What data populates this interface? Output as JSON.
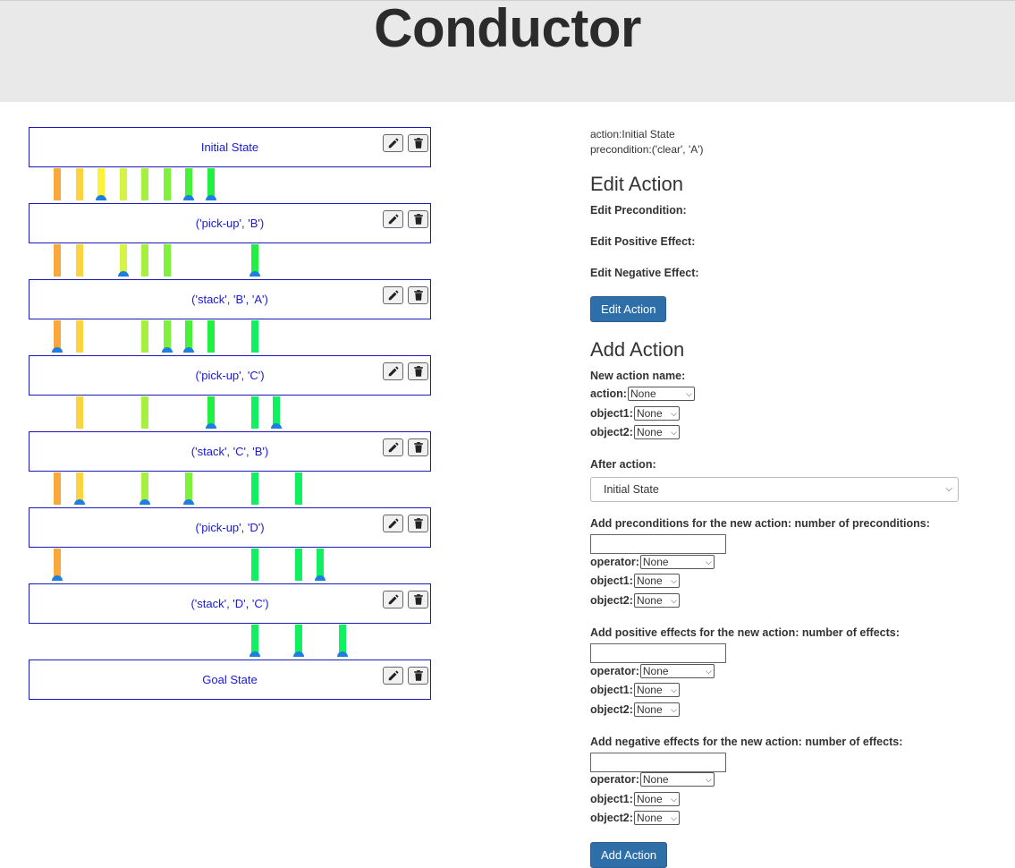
{
  "app": {
    "title": "Conductor"
  },
  "plan": {
    "actions": [
      {
        "label": "Initial State"
      },
      {
        "label": "('pick-up', 'B')"
      },
      {
        "label": "('stack', 'B', 'A')"
      },
      {
        "label": "('pick-up', 'C')"
      },
      {
        "label": "('stack', 'C', 'B')"
      },
      {
        "label": "('pick-up', 'D')"
      },
      {
        "label": "('stack', 'D', 'C')"
      },
      {
        "label": "Goal State"
      }
    ],
    "connector_colors": [
      "#f7a93a",
      "#fdd43f",
      "#fbf337",
      "#d4f545",
      "#a8f03f",
      "#7ef23a",
      "#49f03a",
      "#22f040",
      "#15f050",
      "#10f060"
    ],
    "dot_color": "#1e7fe0",
    "link_columns": [
      {
        "gap": 0,
        "cols": [
          [
            0,
            0,
            0
          ],
          [
            1,
            1,
            0
          ],
          [
            2,
            2,
            1
          ],
          [
            3,
            3,
            0
          ],
          [
            4,
            4,
            0
          ],
          [
            5,
            5,
            0
          ],
          [
            6,
            6,
            1
          ],
          [
            7,
            7,
            1
          ]
        ]
      },
      {
        "gap": 1,
        "cols": [
          [
            0,
            0,
            0
          ],
          [
            1,
            1,
            0
          ],
          [
            3,
            3,
            1
          ],
          [
            4,
            4,
            0
          ],
          [
            5,
            5,
            0
          ],
          [
            9,
            7,
            1
          ]
        ]
      },
      {
        "gap": 2,
        "cols": [
          [
            0,
            0,
            1
          ],
          [
            1,
            1,
            0
          ],
          [
            4,
            4,
            0
          ],
          [
            5,
            5,
            1
          ],
          [
            6,
            6,
            1
          ],
          [
            7,
            7,
            0
          ],
          [
            9,
            9,
            0
          ]
        ]
      },
      {
        "gap": 3,
        "cols": [
          [
            1,
            1,
            0
          ],
          [
            4,
            4,
            0
          ],
          [
            7,
            7,
            1
          ],
          [
            9,
            9,
            0
          ],
          [
            10,
            9,
            1
          ]
        ]
      },
      {
        "gap": 4,
        "cols": [
          [
            0,
            0,
            0
          ],
          [
            1,
            1,
            1
          ],
          [
            4,
            4,
            1
          ],
          [
            6,
            5,
            1
          ],
          [
            9,
            9,
            0
          ],
          [
            11,
            9,
            0
          ]
        ]
      },
      {
        "gap": 5,
        "cols": [
          [
            0,
            0,
            1
          ],
          [
            9,
            9,
            0
          ],
          [
            11,
            9,
            0
          ],
          [
            12,
            9,
            1
          ]
        ]
      },
      {
        "gap": 6,
        "cols": [
          [
            9,
            9,
            1
          ],
          [
            11,
            9,
            1
          ],
          [
            13,
            9,
            1
          ]
        ]
      }
    ]
  },
  "panel": {
    "info": {
      "action_line": "action:Initial State",
      "precondition_line": "precondition:('clear', 'A')"
    },
    "edit": {
      "title": "Edit Action",
      "precondition_label": "Edit Precondition:",
      "positive_label": "Edit Positive Effect:",
      "negative_label": "Edit Negative Effect:",
      "button": "Edit Action"
    },
    "add": {
      "title": "Add Action",
      "name_label": "New action name:",
      "action_field": "action:",
      "action_value": "None",
      "object1_field": "object1:",
      "object2_field": "object2:",
      "object_value": "None",
      "after_label": "After action:",
      "after_value": "Initial State",
      "preconditions_label": "Add preconditions for the new action: number of preconditions:",
      "positive_label": "Add positive effects for the new action: number of effects:",
      "negative_label": "Add negative effects for the new action: number of effects:",
      "operator_field": "operator:",
      "operator_value": "None",
      "button": "Add Action"
    }
  }
}
